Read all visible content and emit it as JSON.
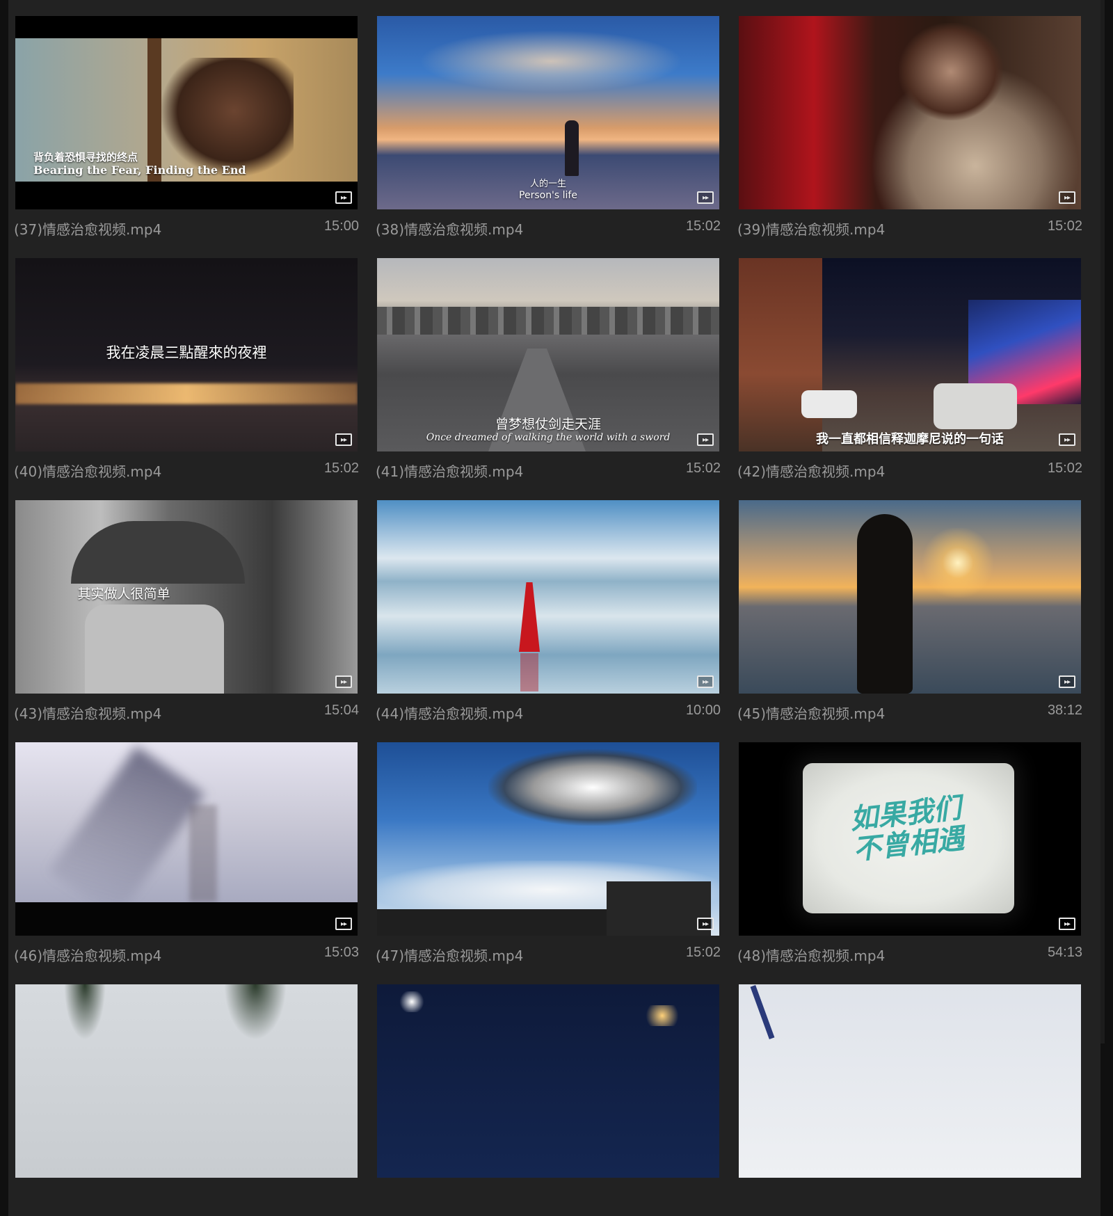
{
  "videos": [
    {
      "name": "(37)情感治愈视频.mp4",
      "duration": "15:00",
      "overlay_cn": "背负着恐惧寻找的终点",
      "overlay_en": "Bearing the Fear, Finding the End"
    },
    {
      "name": "(38)情感治愈视频.mp4",
      "duration": "15:02",
      "overlay_cn": "人的一生",
      "overlay_en": "Person's life"
    },
    {
      "name": "(39)情感治愈视频.mp4",
      "duration": "15:02"
    },
    {
      "name": "(40)情感治愈视频.mp4",
      "duration": "15:02",
      "overlay_cn": "我在凌晨三點醒來的夜裡"
    },
    {
      "name": "(41)情感治愈视频.mp4",
      "duration": "15:02",
      "overlay_cn": "曾梦想仗剑走天涯",
      "overlay_en": "Once dreamed of walking the world with a sword"
    },
    {
      "name": "(42)情感治愈视频.mp4",
      "duration": "15:02",
      "overlay_cn": "我一直都相信释迦摩尼说的一句话"
    },
    {
      "name": "(43)情感治愈视频.mp4",
      "duration": "15:04",
      "overlay_cn": "其实做人很简单"
    },
    {
      "name": "(44)情感治愈视频.mp4",
      "duration": "10:00"
    },
    {
      "name": "(45)情感治愈视频.mp4",
      "duration": "38:12"
    },
    {
      "name": "(46)情感治愈视频.mp4",
      "duration": "15:03"
    },
    {
      "name": "(47)情感治愈视频.mp4",
      "duration": "15:02"
    },
    {
      "name": "(48)情感治愈视频.mp4",
      "duration": "54:13",
      "logo_text": "如果我们不曾相遇"
    },
    {},
    {},
    {}
  ],
  "badge_icon": "audio-video-icon",
  "colors": {
    "background": "#1c1c1c",
    "cell": "#222222",
    "label": "#9a9a9a"
  }
}
